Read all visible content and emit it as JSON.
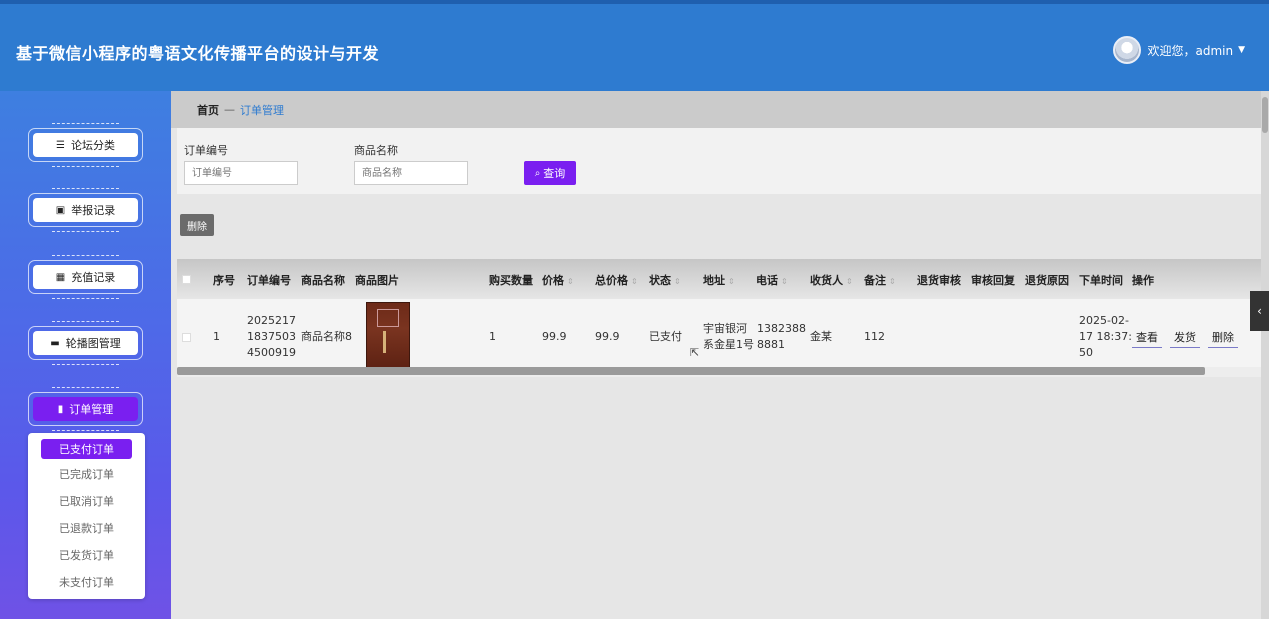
{
  "header": {
    "title": "基于微信小程序的粤语文化传播平台的设计与开发",
    "welcome": "欢迎您，admin"
  },
  "sidebar": {
    "items": [
      {
        "label": "论坛分类",
        "icon": "list-icon"
      },
      {
        "label": "举报记录",
        "icon": "clipboard-icon"
      },
      {
        "label": "充值记录",
        "icon": "grid-icon"
      },
      {
        "label": "轮播图管理",
        "icon": "chat-icon"
      },
      {
        "label": "订单管理",
        "icon": "bar-chart-icon"
      }
    ],
    "submenu": [
      "已支付订单",
      "已完成订单",
      "已取消订单",
      "已退款订单",
      "已发货订单",
      "未支付订单"
    ]
  },
  "breadcrumb": {
    "home": "首页",
    "separator": "—",
    "current": "订单管理"
  },
  "search": {
    "order_no_label": "订单编号",
    "order_no_placeholder": "订单编号",
    "product_label": "商品名称",
    "product_placeholder": "商品名称",
    "query_label": "查询"
  },
  "toolbar": {
    "delete_label": "删除"
  },
  "table": {
    "columns": [
      "序号",
      "订单编号",
      "商品名称",
      "商品图片",
      "购买数量",
      "价格",
      "总价格",
      "状态",
      "地址",
      "电话",
      "收货人",
      "备注",
      "退货审核",
      "审核回复",
      "退货原因",
      "下单时间",
      "操作"
    ],
    "rows": [
      {
        "index": "1",
        "order_no_lines": [
          "2025217",
          "1837503",
          "4500919"
        ],
        "product": "商品名称8",
        "quantity": "1",
        "price": "99.9",
        "total": "99.9",
        "status": "已支付",
        "address_lines": [
          "宇宙银河",
          "系金星1号"
        ],
        "phone_lines": [
          "1382388",
          "8881"
        ],
        "receiver": "金某",
        "note": "112",
        "return_review": "",
        "review_reply": "",
        "return_reason": "",
        "time_lines": [
          "2025-02-",
          "17 18:37:",
          "50"
        ],
        "actions": [
          "查看",
          "发货",
          "删除"
        ]
      }
    ]
  },
  "colors": {
    "header": "#2e7bd0",
    "accent": "#7a1ff0"
  }
}
